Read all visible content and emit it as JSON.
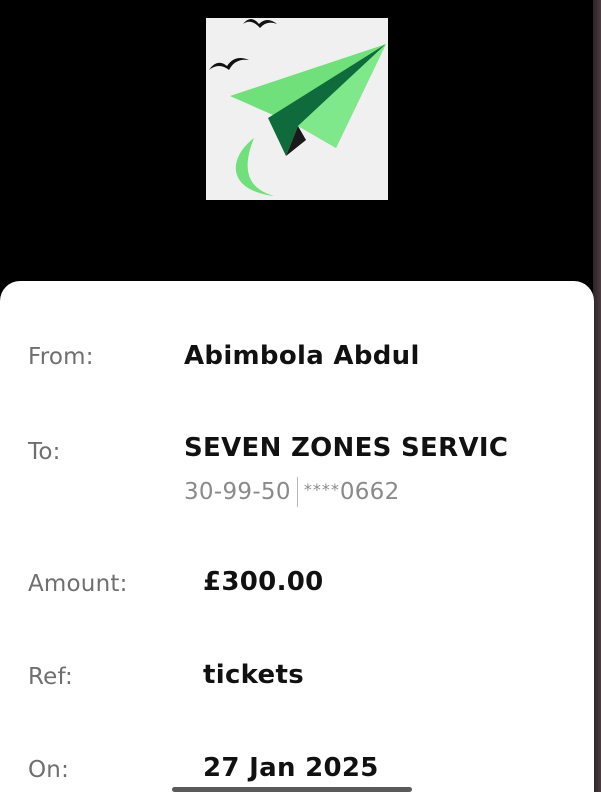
{
  "logo": {
    "icon": "paper-plane-logo",
    "colors": {
      "background": "#f0f0f0",
      "plane_light": "#6fe07a",
      "plane_dark": "#0f6b3b",
      "plane_tail": "#1a1a1a",
      "birds": "#111111"
    }
  },
  "details": {
    "from": {
      "label": "From:",
      "value": "Abimbola Abdul"
    },
    "to": {
      "label": "To:",
      "value": "SEVEN ZONES SERVIC",
      "sort_code": "30-99-50",
      "account_mask": "****",
      "account_last4": "0662"
    },
    "amount": {
      "label": "Amount:",
      "value": "£300.00"
    },
    "ref": {
      "label": "Ref:",
      "value": "tickets"
    },
    "on": {
      "label": "On:",
      "value": "27 Jan 2025"
    }
  },
  "colors": {
    "page_background": "#000000",
    "card_background": "#ffffff",
    "label_text": "#6f6f6f",
    "value_text": "#111111",
    "secondary_text": "#8a8a8a"
  }
}
